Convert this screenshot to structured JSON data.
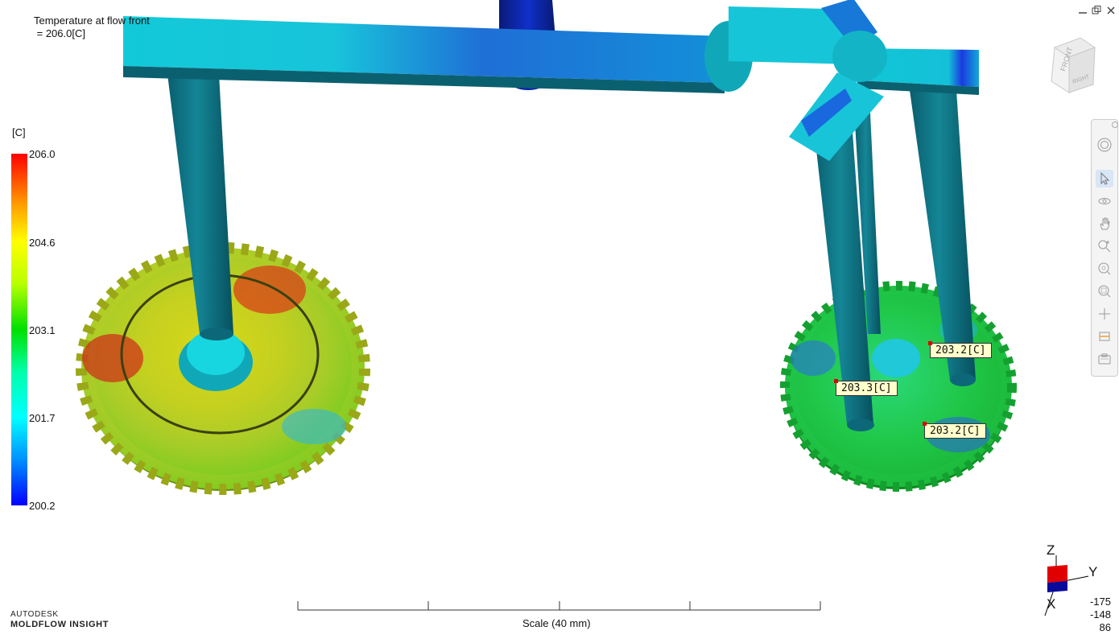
{
  "result": {
    "title_line1": "Temperature at flow front",
    "title_line2": " = 206.0[C]"
  },
  "legend": {
    "unit": "[C]",
    "labels": [
      "206.0",
      "204.6",
      "203.1",
      "201.7",
      "200.2"
    ],
    "colors": {
      "max": "#ff0000",
      "mid": "#00e000",
      "min": "#0000ff"
    }
  },
  "callouts": [
    {
      "text": "203.2[C]"
    },
    {
      "text": "203.3[C]"
    },
    {
      "text": "203.2[C]"
    }
  ],
  "scale": {
    "label": "Scale (40 mm)"
  },
  "brand": {
    "line1": "AUTODESK",
    "line2": "MOLDFLOW INSIGHT"
  },
  "triad": {
    "z": "Z",
    "y": "Y",
    "x": "X"
  },
  "coordinates": [
    "-175",
    "-148",
    "86"
  ],
  "viewcube": {
    "front": "FRONT",
    "right": "RIGHT"
  },
  "window_controls": [
    "minimize-icon",
    "restore-icon",
    "close-icon"
  ],
  "toolbar": [
    "steering-wheel-icon",
    "select-icon",
    "orbit-icon",
    "pan-icon",
    "zoom-region-icon",
    "zoom-icon",
    "zoom-fit-icon",
    "center-icon",
    "section-icon",
    "snapshot-icon"
  ]
}
